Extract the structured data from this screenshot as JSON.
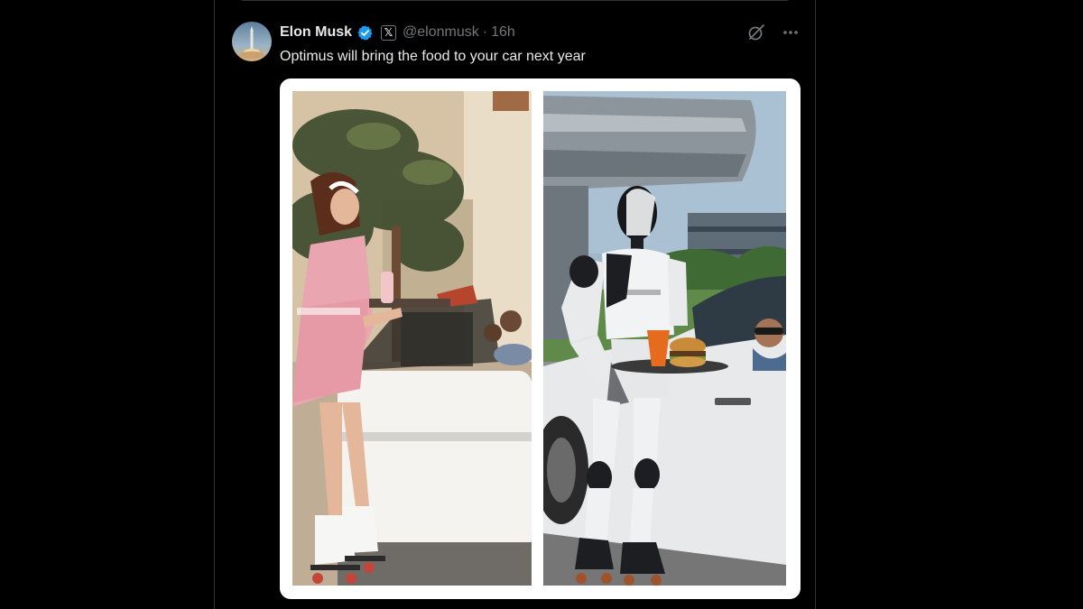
{
  "post": {
    "author": {
      "display_name": "Elon Musk",
      "verified_icon": "verified-badge-icon",
      "affiliation_badge": "𝕏",
      "handle": "@elonmusk",
      "separator": "·",
      "timestamp": "16h"
    },
    "actions": {
      "grok_icon": "grok-icon",
      "more_icon": "more-dots-icon"
    },
    "text": "Optimus will bring the food to your car next year",
    "media": {
      "left_panel": "waitress-carhop-photo",
      "right_panel": "optimus-robot-carhop-photo"
    }
  },
  "colors": {
    "background": "#000000",
    "text_primary": "#e7e9ea",
    "text_secondary": "#71767b",
    "verified_blue": "#1d9bf0",
    "border": "#2f3336",
    "media_frame": "#ffffff"
  }
}
